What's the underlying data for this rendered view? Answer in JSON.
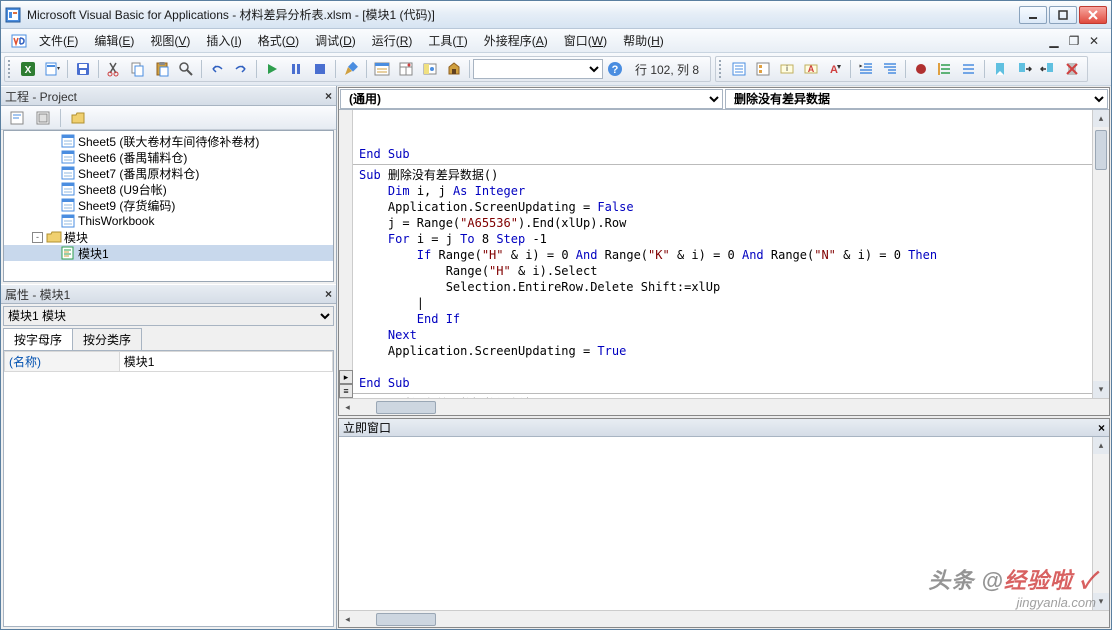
{
  "title": "Microsoft Visual Basic for Applications - 材料差异分析表.xlsm - [模块1 (代码)]",
  "menus": [
    "文件(F)",
    "编辑(E)",
    "视图(V)",
    "插入(I)",
    "格式(O)",
    "调试(D)",
    "运行(R)",
    "工具(T)",
    "外接程序(A)",
    "窗口(W)",
    "帮助(H)"
  ],
  "position_label": "行 102, 列 8",
  "project": {
    "panel_title": "工程 - Project",
    "items": [
      {
        "indent": 56,
        "icon": "sheet",
        "label": "Sheet5 (联大卷材车间待修补卷材)"
      },
      {
        "indent": 56,
        "icon": "sheet",
        "label": "Sheet6 (番禺辅料仓)"
      },
      {
        "indent": 56,
        "icon": "sheet",
        "label": "Sheet7 (番禺原材料仓)"
      },
      {
        "indent": 56,
        "icon": "sheet",
        "label": "Sheet8 (U9台帐)"
      },
      {
        "indent": 56,
        "icon": "sheet",
        "label": "Sheet9 (存货编码)"
      },
      {
        "indent": 56,
        "icon": "sheet",
        "label": "ThisWorkbook"
      },
      {
        "indent": 28,
        "icon": "folder",
        "label": "模块",
        "toggle": "-"
      },
      {
        "indent": 56,
        "icon": "module",
        "label": "模块1",
        "selected": true
      }
    ]
  },
  "properties": {
    "panel_title": "属性 - 模块1",
    "object_combo": "模块1 模块",
    "tabs": [
      "按字母序",
      "按分类序"
    ],
    "active_tab": 0,
    "rows": [
      {
        "key": "(名称)",
        "value": "模块1"
      }
    ]
  },
  "code": {
    "object_dropdown": "(通用)",
    "proc_dropdown": "删除没有差异数据",
    "lines": [
      "",
      "",
      "<kw>End Sub</kw>",
      "<hr>",
      "<kw>Sub</kw> 删除没有差异数据()",
      "    <kw>Dim</kw> i, j <kw>As Integer</kw>",
      "    Application.ScreenUpdating = <kw>False</kw>",
      "    j = Range(<str>\"A65536\"</str>).End(xlUp).Row",
      "    <kw>For</kw> i = j <kw>To</kw> 8 <kw>Step</kw> -1",
      "        <kw>If</kw> Range(<str>\"H\"</str> & i) = 0 <kw>And</kw> Range(<str>\"K\"</str> & i) = 0 <kw>And</kw> Range(<str>\"N\"</str> & i) = 0 <kw>Then</kw>",
      "            Range(<str>\"H\"</str> & i).Select",
      "            Selection.EntireRow.Delete Shift:=xlUp",
      "        |",
      "        <kw>End If</kw>",
      "    <kw>Next</kw>",
      "    Application.ScreenUpdating = <kw>True</kw>",
      "",
      "<kw>End Sub</kw>",
      "<hr>",
      "<kw>Sub</kw> 删除没有差异数据数组方法()"
    ]
  },
  "immediate": {
    "title": "立即窗口"
  },
  "watermark": {
    "line1a": "头条 @",
    "line1b": "经验啦",
    "line2": "jingyanla.com"
  }
}
